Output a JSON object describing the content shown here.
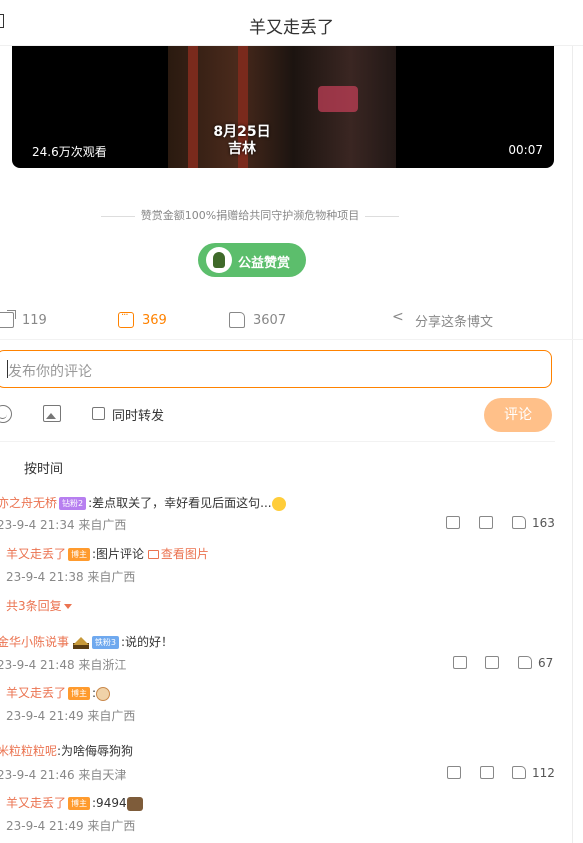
{
  "header": {
    "title": "羊又走丢了"
  },
  "video": {
    "views": "24.6万次观看",
    "duration": "00:07",
    "caption_date": "8月25日",
    "caption_place": "吉林"
  },
  "donation": {
    "note": "赞赏金额100%捐赠给共同守护濒危物种项目",
    "button_label": "公益赞赏"
  },
  "actions": {
    "forward_count": "119",
    "comment_count": "369",
    "like_count": "3607",
    "share_label": "分享这条博文"
  },
  "composer": {
    "placeholder": "发布你的评论",
    "repost_label": "同时转发",
    "submit_label": "评论"
  },
  "sort": {
    "label": "按时间"
  },
  "comments": [
    {
      "user": "亦之舟无桥",
      "badge": "钻粉2",
      "text": ":差点取关了，幸好看见后面这句...",
      "meta": "23-9-4 21:34 来自广西",
      "likes": "163",
      "reply": {
        "user": "羊又走丢了",
        "badge": "博主",
        "text": ":图片评论",
        "link": "查看图片",
        "meta": "23-9-4 21:38 来自广西"
      },
      "more_replies": "共3条回复"
    },
    {
      "user": "金华小陈说事",
      "badge": "铁粉3",
      "text": ":说的好！",
      "meta": "23-9-4 21:48 来自浙江",
      "likes": "67",
      "reply": {
        "user": "羊又走丢了",
        "badge": "博主",
        "text": ":",
        "meta": "23-9-4 21:49 来自广西"
      }
    },
    {
      "user": "米粒粒粒呢",
      "text": ":为啥侮辱狗狗",
      "meta": "23-9-4 21:46 来自天津",
      "likes": "112",
      "reply": {
        "user": "羊又走丢了",
        "badge": "博主",
        "text": ":9494",
        "meta": "23-9-4 21:49 来自广西"
      }
    }
  ],
  "colors": {
    "accent": "#ff8200",
    "username": "#eb7350",
    "donate_green": "#5cbe6c",
    "submit_disabled": "#ffc089"
  }
}
